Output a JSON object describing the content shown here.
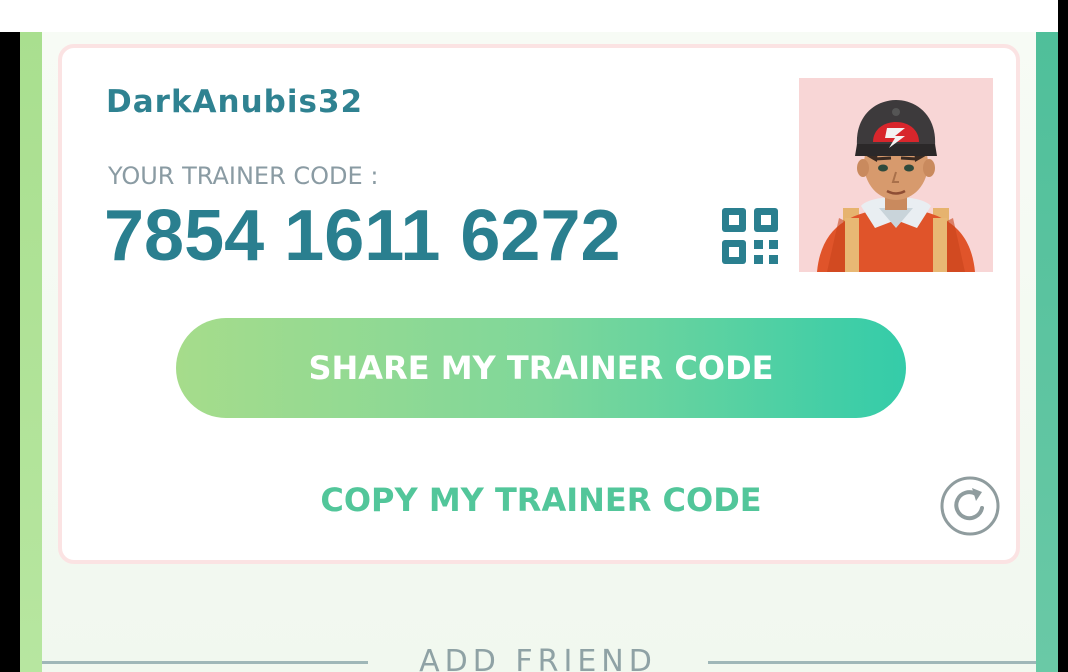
{
  "profile": {
    "username": "DarkAnubis32",
    "code_label": "YOUR TRAINER CODE :",
    "trainer_code": "7854 1611 6272"
  },
  "actions": {
    "share_label": "SHARE MY TRAINER CODE",
    "copy_label": "COPY MY TRAINER CODE"
  },
  "section": {
    "add_friend_label": "ADD FRIEND"
  },
  "icons": {
    "qr": "qr-code-icon",
    "refresh": "refresh-icon",
    "avatar": "trainer-avatar"
  },
  "colors": {
    "username": "#2f8291",
    "trainer_code": "#2a7f8f",
    "label": "#8a9ba3",
    "accent_green": "#52c69a",
    "button_gradient_start": "#a6dc8b",
    "button_gradient_end": "#34cca9",
    "avatar_bg": "#f8d6d6"
  }
}
